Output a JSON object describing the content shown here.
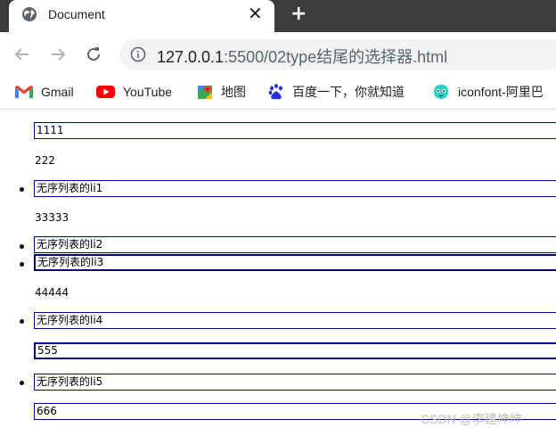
{
  "tab": {
    "title": "Document"
  },
  "omnibox": {
    "url_host": "127.0.0.1",
    "url_rest": ":5500/02type结尾的选择器.html"
  },
  "bookmarks": [
    {
      "label": "Gmail",
      "icon": "gmail-icon"
    },
    {
      "label": "YouTube",
      "icon": "youtube-icon"
    },
    {
      "label": "地图",
      "icon": "maps-icon"
    },
    {
      "label": "百度一下，你就知道",
      "icon": "baidu-icon"
    },
    {
      "label": "iconfont-阿里巴",
      "icon": "iconfont-icon"
    }
  ],
  "page": {
    "p1": "1111",
    "p2": "222",
    "li1": "无序列表的li1",
    "p3": "33333",
    "li2": "无序列表的li2",
    "li3": "无序列表的li3",
    "p4": "44444",
    "li4": "无序列表的li4",
    "p5": "555",
    "li5": "无序列表的li5",
    "p6": "666"
  },
  "watermark": "CSDN @李建坤坤",
  "colors": {
    "tabstrip": "#3c3c3c",
    "outline": "#00008b"
  }
}
